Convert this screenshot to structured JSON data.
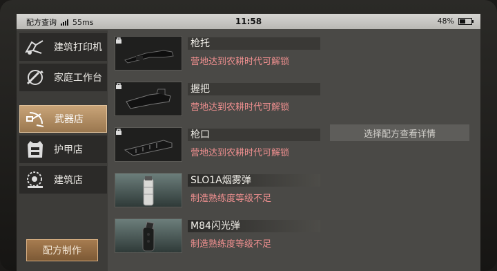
{
  "statusbar": {
    "app": "配方查询",
    "ping": "55ms",
    "time": "11:58",
    "battery": "48%",
    "battery_level": 0.48
  },
  "sidebar": {
    "items": [
      {
        "label": "建筑打印机",
        "icon": "printer-icon",
        "active": false
      },
      {
        "label": "家庭工作台",
        "icon": "workbench-icon",
        "active": false
      },
      {
        "label": "武器店",
        "icon": "weapon-shop-icon",
        "active": true
      },
      {
        "label": "护甲店",
        "icon": "armor-icon",
        "active": false
      },
      {
        "label": "建筑店",
        "icon": "saw-icon",
        "active": false
      }
    ],
    "craft_button": "配方制作"
  },
  "items": [
    {
      "name": "枪托",
      "status": "营地达到农耕时代可解锁",
      "locked": true,
      "icon": "stock-icon"
    },
    {
      "name": "握把",
      "status": "营地达到农耕时代可解锁",
      "locked": true,
      "icon": "grip-icon"
    },
    {
      "name": "枪口",
      "status": "营地达到农耕时代可解锁",
      "locked": true,
      "icon": "muzzle-icon"
    },
    {
      "name": "SLO1A烟雾弹",
      "status": "制造熟练度等级不足",
      "locked": false,
      "icon": "smoke-grenade-icon"
    },
    {
      "name": "M84闪光弹",
      "status": "制造熟练度等级不足",
      "locked": false,
      "icon": "flashbang-icon"
    }
  ],
  "detail": {
    "placeholder": "选择配方查看详情"
  },
  "colors": {
    "accent": "#b38d62",
    "warning_text": "#ee8f8f"
  }
}
